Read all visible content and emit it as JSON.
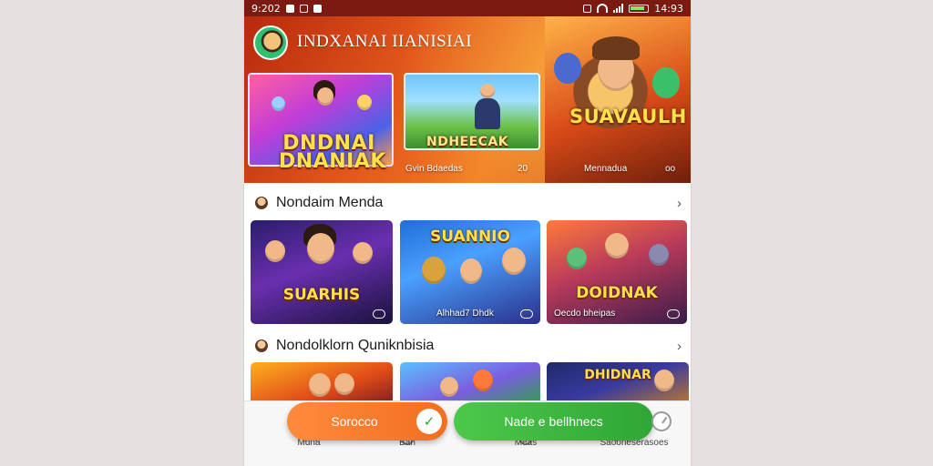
{
  "status_bar": {
    "time_left": "9:202",
    "time_right": "14:93"
  },
  "header": {
    "app_title": "INDXANAI IIANISIAI"
  },
  "hero": {
    "badge_1": "DNDNAI DNANIAK",
    "badge_2": "NDHEECAK",
    "badge_3": "SUAVAULH",
    "caption_1": "Gvin Bdaedas",
    "caption_2": "20",
    "caption_3": "Mennadua",
    "caption_4": "oo"
  },
  "sections": [
    {
      "title": "Nondaim Menda",
      "chevron": "›",
      "tiles": [
        {
          "title": "SUARHIS",
          "caption": ""
        },
        {
          "title": "SUANNIO",
          "caption": "Alhhad7 Dhdk"
        },
        {
          "title": "DOIDNAK",
          "caption": "Oecdo bheipas"
        }
      ]
    },
    {
      "title": "Nondolklorn Quniknbisia",
      "chevron": "›",
      "tiles": [
        {
          "title": "",
          "caption": ""
        },
        {
          "title": "",
          "caption": ""
        },
        {
          "title": "DHIDNAR",
          "caption": ""
        }
      ]
    }
  ],
  "actions": {
    "primary_label": "Sorocco",
    "secondary_label": "Nade e bellhnecs",
    "leaf_glyph": "✓"
  },
  "bottom_nav": [
    {
      "label": "Mdna"
    },
    {
      "label": "Ban"
    },
    {
      "label": "Meas"
    },
    {
      "label": "Saooneserasoes"
    }
  ],
  "colors": {
    "hero_accent": "#e2561b",
    "primary_button": "#f26f1f",
    "secondary_button": "#2fa636"
  }
}
